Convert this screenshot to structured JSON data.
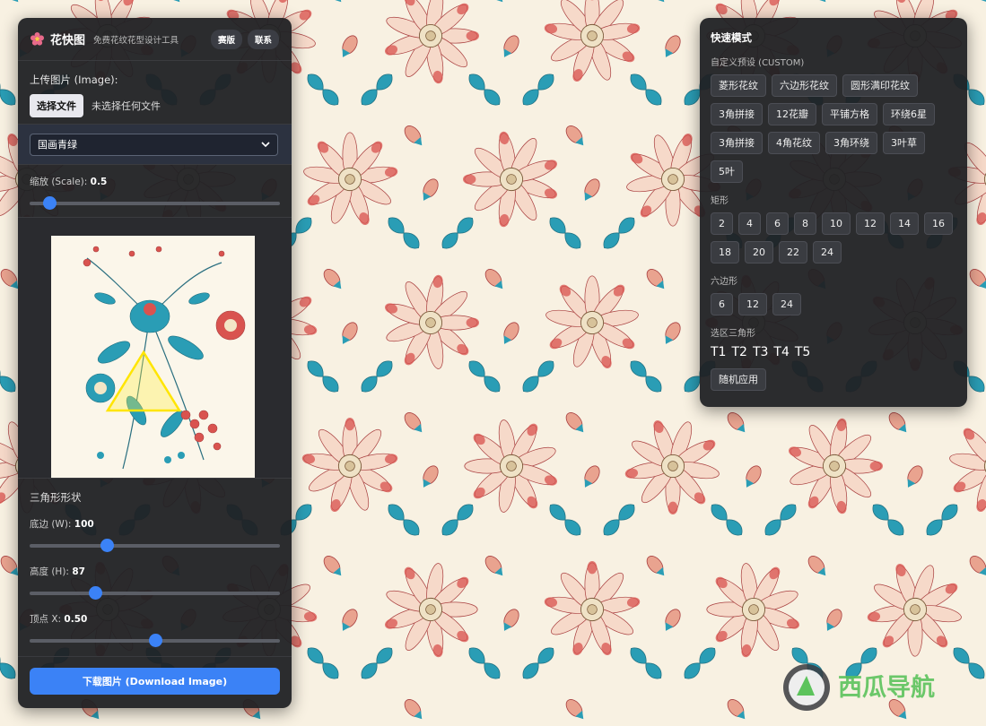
{
  "header": {
    "title": "花快图",
    "subtitle": "免费花纹花型设计工具",
    "btn_donate": "赛版",
    "btn_contact": "联系"
  },
  "upload": {
    "label": "上传图片 (Image):",
    "choose_file": "选择文件",
    "file_status": "未选择任何文件"
  },
  "palette_select": {
    "value": "国画青绿"
  },
  "scale": {
    "label": "缩放 (Scale):",
    "value": "0.5",
    "fraction": 0.08
  },
  "triangle": {
    "title": "三角形形状",
    "base": {
      "label": "底边 (W):",
      "value": "100",
      "fraction": 0.31
    },
    "height": {
      "label": "高度 (H):",
      "value": "87",
      "fraction": 0.26
    },
    "apex": {
      "label": "顶点 X:",
      "value": "0.50",
      "fraction": 0.5
    }
  },
  "download": {
    "label": "下载图片 (Download Image)"
  },
  "quick": {
    "title": "快速模式",
    "custom_label": "自定义预设 (CUSTOM)",
    "custom": [
      "菱形花纹",
      "六边形花纹",
      "圆形满印花纹",
      "3角拼接",
      "12花瓣",
      "平铺方格",
      "环绕6星",
      "3角拼接",
      "4角花纹",
      "3角环绕",
      "3叶草",
      "5叶"
    ],
    "rect_label": "矩形",
    "rect": [
      "2",
      "4",
      "6",
      "8",
      "10",
      "12",
      "14",
      "16",
      "18",
      "20",
      "22",
      "24"
    ],
    "hex_label": "六边形",
    "hex": [
      "6",
      "12",
      "24"
    ],
    "tri_label": "选区三角形",
    "tri": [
      "T1",
      "T2",
      "T3",
      "T4",
      "T5"
    ],
    "random": "随机应用"
  },
  "watermark": {
    "text": "西瓜导航"
  },
  "colors": {
    "accent": "#3b82f6",
    "panel": "#202124",
    "pattern_red": "#d9534f",
    "pattern_teal": "#2a9db5"
  }
}
